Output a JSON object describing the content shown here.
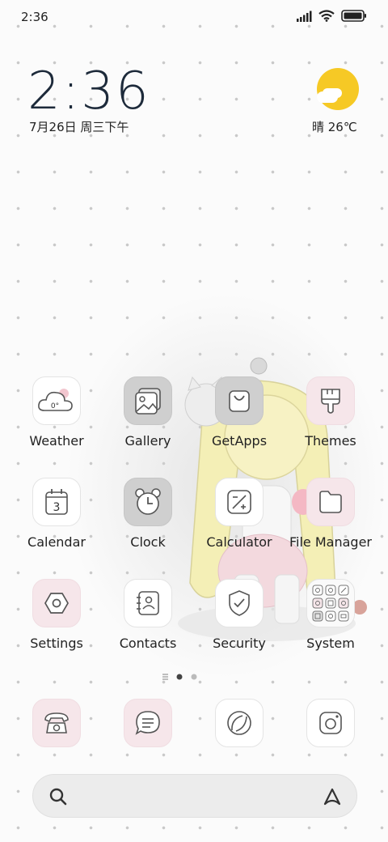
{
  "status_bar": {
    "time": "2:36"
  },
  "clock_widget": {
    "time": "2:36",
    "date": "7月26日 周三下午"
  },
  "weather_widget": {
    "text": "晴 26℃"
  },
  "apps": [
    {
      "label": "Weather",
      "icon": "weather-cloud-icon",
      "icon_text": "0°"
    },
    {
      "label": "Gallery",
      "icon": "gallery-icon"
    },
    {
      "label": "GetApps",
      "icon": "shopping-bag-icon"
    },
    {
      "label": "Themes",
      "icon": "paint-brush-icon"
    },
    {
      "label": "Calendar",
      "icon": "calendar-icon",
      "icon_text": "3"
    },
    {
      "label": "Clock",
      "icon": "alarm-clock-icon"
    },
    {
      "label": "Calculator",
      "icon": "calculator-icon"
    },
    {
      "label": "File Manager",
      "icon": "folder-icon"
    },
    {
      "label": "Settings",
      "icon": "hexagon-settings-icon"
    },
    {
      "label": "Contacts",
      "icon": "contacts-book-icon"
    },
    {
      "label": "Security",
      "icon": "shield-icon"
    },
    {
      "label": "System",
      "icon": "app-folder-icon"
    }
  ],
  "pager": {
    "pages": 2,
    "current": 1
  },
  "dock": [
    {
      "icon": "phone-icon"
    },
    {
      "icon": "message-icon"
    },
    {
      "icon": "browser-icon"
    },
    {
      "icon": "camera-icon"
    }
  ],
  "colors": {
    "pink_tile": "#f6e6ea",
    "grey_tile": "#cfcfcf",
    "sun": "#f6c925",
    "clock_text": "#1d2a3a"
  }
}
